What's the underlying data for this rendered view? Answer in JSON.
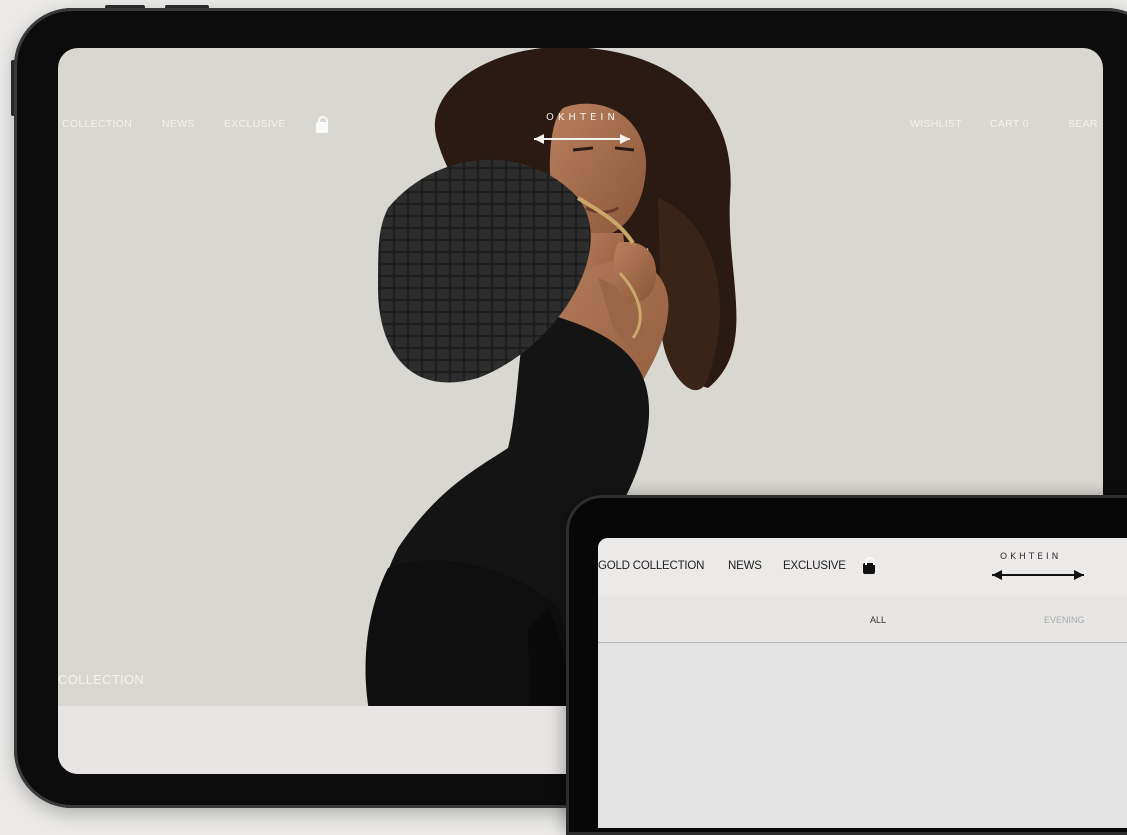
{
  "back_site": {
    "nav_left": [
      "COLLECTION",
      "NEWS",
      "EXCLUSIVE"
    ],
    "nav_right": [
      "WISHLIST",
      "CART 0",
      "SEAR"
    ],
    "logo": "OKHTEIN",
    "hero_caption": "COLLECTION",
    "lock_icon": "lock-icon"
  },
  "front_site": {
    "nav_left": [
      "GOLD COLLECTION",
      "NEWS",
      "EXCLUSIVE"
    ],
    "logo": "OKHTEIN",
    "filters": [
      "ALL",
      "EVENING"
    ],
    "lock_icon": "lock-icon"
  },
  "colors": {
    "back_screen_bg": "#d9d7d1",
    "front_screen_bg": "#e3e3e3",
    "device_frame": "#0c0c0c",
    "nav_text_light": "#f4f3f0",
    "nav_text_dark": "#222222"
  }
}
